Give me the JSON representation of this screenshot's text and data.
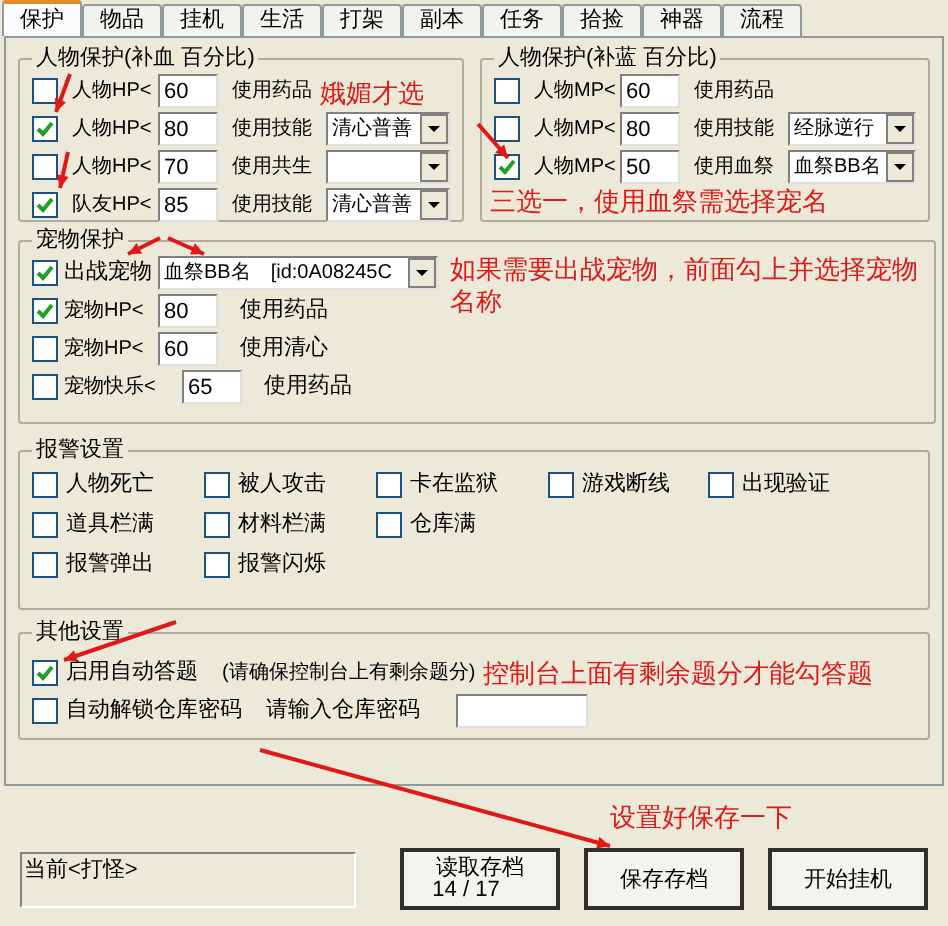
{
  "tabs": [
    {
      "label": "保护",
      "selected": true
    },
    {
      "label": "物品",
      "selected": false
    },
    {
      "label": "挂机",
      "selected": false
    },
    {
      "label": "生活",
      "selected": false
    },
    {
      "label": "打架",
      "selected": false
    },
    {
      "label": "副本",
      "selected": false
    },
    {
      "label": "任务",
      "selected": false
    },
    {
      "label": "拾捡",
      "selected": false
    },
    {
      "label": "神器",
      "selected": false
    },
    {
      "label": "流程",
      "selected": false
    }
  ],
  "hp_group": {
    "title": "人物保护(补血 百分比)",
    "note": "娥媚才选",
    "rows": [
      {
        "kind": "plain",
        "checked": false,
        "label": "人物HP<",
        "value": "60",
        "action": "使用药品"
      },
      {
        "kind": "select",
        "checked": true,
        "label": "人物HP<",
        "value": "80",
        "action": "使用技能",
        "selection": "清心普善"
      },
      {
        "kind": "select",
        "checked": false,
        "label": "人物HP<",
        "value": "70",
        "action": "使用共生"
      },
      {
        "kind": "select",
        "checked": true,
        "label": "队友HP<",
        "value": "85",
        "action": "使用技能",
        "selection": "清心普善"
      }
    ]
  },
  "mp_group": {
    "title": "人物保护(补蓝 百分比)",
    "note": "三选一，使用血祭需选择宠名",
    "rows": [
      {
        "kind": "plain",
        "checked": false,
        "label": "人物MP<",
        "value": "60",
        "action": "使用药品"
      },
      {
        "kind": "select",
        "checked": false,
        "label": "人物MP<",
        "value": "80",
        "action": "使用技能",
        "selection": "经脉逆行"
      },
      {
        "kind": "select",
        "checked": true,
        "label": "人物MP<",
        "value": "50",
        "action": "使用血祭",
        "selection": "血祭BB名"
      }
    ]
  },
  "pet_group": {
    "title": "宠物保护",
    "note": "如果需要出战宠物，前面勾上并选择宠物名称",
    "battle_pet": {
      "checked": true,
      "label": "出战宠物",
      "pet_name": "血祭BB名",
      "pet_id": "[id:0A08245C"
    },
    "rows": [
      {
        "checked": true,
        "label": "宠物HP<",
        "value": "80",
        "action": "使用药品"
      },
      {
        "checked": false,
        "label": "宠物HP<",
        "value": "60",
        "action": "使用清心"
      },
      {
        "checked": false,
        "label": "宠物快乐<",
        "value": "65",
        "action": "使用药品"
      }
    ]
  },
  "alert_group": {
    "title": "报警设置",
    "rows": [
      [
        {
          "label": "人物死亡",
          "checked": false
        },
        {
          "label": "被人攻击",
          "checked": false
        },
        {
          "label": "卡在监狱",
          "checked": false
        },
        {
          "label": "游戏断线",
          "checked": false
        },
        {
          "label": "出现验证",
          "checked": false
        }
      ],
      [
        {
          "label": "道具栏满",
          "checked": false
        },
        {
          "label": "材料栏满",
          "checked": false
        },
        {
          "label": "仓库满",
          "checked": false
        }
      ],
      [
        {
          "label": "报警弹出",
          "checked": false
        },
        {
          "label": "报警闪烁",
          "checked": false
        }
      ]
    ]
  },
  "other_group": {
    "title": "其他设置",
    "note": "控制台上面有剩余题分才能勾答题",
    "auto_answer": {
      "checked": true,
      "label": "启用自动答题",
      "hint": "(请确保控制台上有剩余题分)"
    },
    "unlock": {
      "checked": false,
      "label": "自动解锁仓库密码",
      "prompt": "请输入仓库密码"
    }
  },
  "status": "当前<打怪>",
  "save_note": "设置好保存一下",
  "buttons": [
    {
      "label": "读取存档",
      "counter": "14 / 17"
    },
    {
      "label": "保存存档"
    },
    {
      "label": "开始挂机"
    }
  ]
}
